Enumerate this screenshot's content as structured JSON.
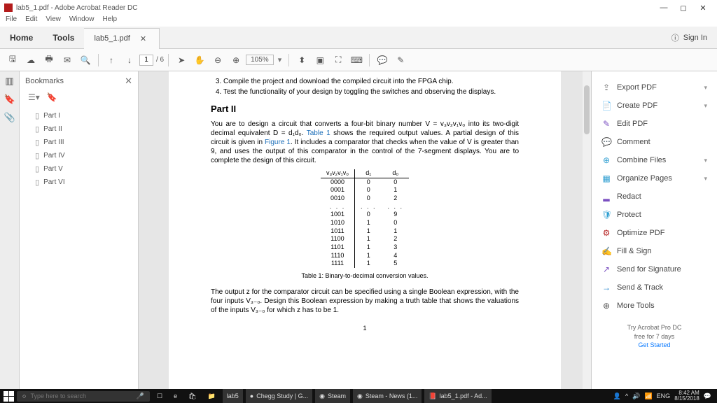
{
  "window": {
    "title": "lab5_1.pdf - Adobe Acrobat Reader DC"
  },
  "menubar": [
    "File",
    "Edit",
    "View",
    "Window",
    "Help"
  ],
  "tabs": {
    "home": "Home",
    "tools": "Tools",
    "doc": "lab5_1.pdf",
    "signin": "Sign In"
  },
  "toolbar": {
    "page": "1",
    "total": "/ 6",
    "zoom": "105%"
  },
  "bookmarks": {
    "title": "Bookmarks",
    "items": [
      "Part I",
      "Part II",
      "Part III",
      "Part IV",
      "Part V",
      "Part VI"
    ]
  },
  "doc": {
    "li3": "Compile the project and download the compiled circuit into the FPGA chip.",
    "li4": "Test the functionality of your design by toggling the switches and observing the displays.",
    "h": "Part II",
    "p1a": "You are to design a circuit that converts a four-bit binary number V = v₃v₂v₁v₀ into its two-digit decimal equivalent D = d₁d₀. ",
    "p1b": "Table 1",
    "p1c": " shows the required output values. A partial design of this circuit is given in ",
    "p1d": "Figure 1",
    "p1e": ". It includes a comparator that checks when the value of V is greater than 9, and uses the output of this comparator in the control of the 7-segment displays. You are to complete the design of this circuit.",
    "th": [
      "v₃v₂v₁v₀",
      "d₁",
      "d₀"
    ],
    "rows1": [
      [
        "0000",
        "0",
        "0"
      ],
      [
        "0001",
        "0",
        "1"
      ],
      [
        "0010",
        "0",
        "2"
      ]
    ],
    "dots": [
      ". . .",
      ". . .",
      ". . ."
    ],
    "rows2": [
      [
        "1001",
        "0",
        "9"
      ],
      [
        "1010",
        "1",
        "0"
      ],
      [
        "1011",
        "1",
        "1"
      ],
      [
        "1100",
        "1",
        "2"
      ],
      [
        "1101",
        "1",
        "3"
      ],
      [
        "1110",
        "1",
        "4"
      ],
      [
        "1111",
        "1",
        "5"
      ]
    ],
    "caption": "Table 1: Binary-to-decimal conversion values.",
    "p2": "The output z for the comparator circuit can be specified using a single Boolean expression, with the four inputs V₃₋₀. Design this Boolean expression by making a truth table that shows the valuations of the inputs V₃₋₀ for which z has to be 1.",
    "pagenum": "1"
  },
  "right": {
    "items": [
      {
        "icon": "⇪",
        "label": "Export PDF",
        "chev": true,
        "color": "#777"
      },
      {
        "icon": "📄",
        "label": "Create PDF",
        "chev": true,
        "color": "#b31b1b"
      },
      {
        "icon": "✎",
        "label": "Edit PDF",
        "chev": false,
        "color": "#7a4fc1"
      },
      {
        "icon": "💬",
        "label": "Comment",
        "chev": false,
        "color": "#f5a623"
      },
      {
        "icon": "⊕",
        "label": "Combine Files",
        "chev": true,
        "color": "#32a0d2"
      },
      {
        "icon": "▦",
        "label": "Organize Pages",
        "chev": true,
        "color": "#32a0d2"
      },
      {
        "icon": "▂",
        "label": "Redact",
        "chev": false,
        "color": "#7a4fc1"
      },
      {
        "icon": "🛡",
        "label": "Protect",
        "chev": false,
        "color": "#32a0d2"
      },
      {
        "icon": "⚙",
        "label": "Optimize PDF",
        "chev": false,
        "color": "#b31b1b"
      },
      {
        "icon": "✍",
        "label": "Fill & Sign",
        "chev": false,
        "color": "#7a4fc1"
      },
      {
        "icon": "↗",
        "label": "Send for Signature",
        "chev": false,
        "color": "#7a4fc1"
      },
      {
        "icon": "→",
        "label": "Send & Track",
        "chev": false,
        "color": "#1079c9"
      },
      {
        "icon": "⊕",
        "label": "More Tools",
        "chev": false,
        "color": "#555"
      }
    ],
    "trial1": "Try Acrobat Pro DC",
    "trial2": "free for 7 days",
    "trial3": "Get Started"
  },
  "taskbar": {
    "search_ph": "Type here to search",
    "items": [
      "lab5",
      "Chegg Study | G...",
      "Steam",
      "Steam - News (1...",
      "lab5_1.pdf - Ad..."
    ],
    "lang": "ENG",
    "time": "8:42 AM",
    "date": "8/15/2018"
  }
}
